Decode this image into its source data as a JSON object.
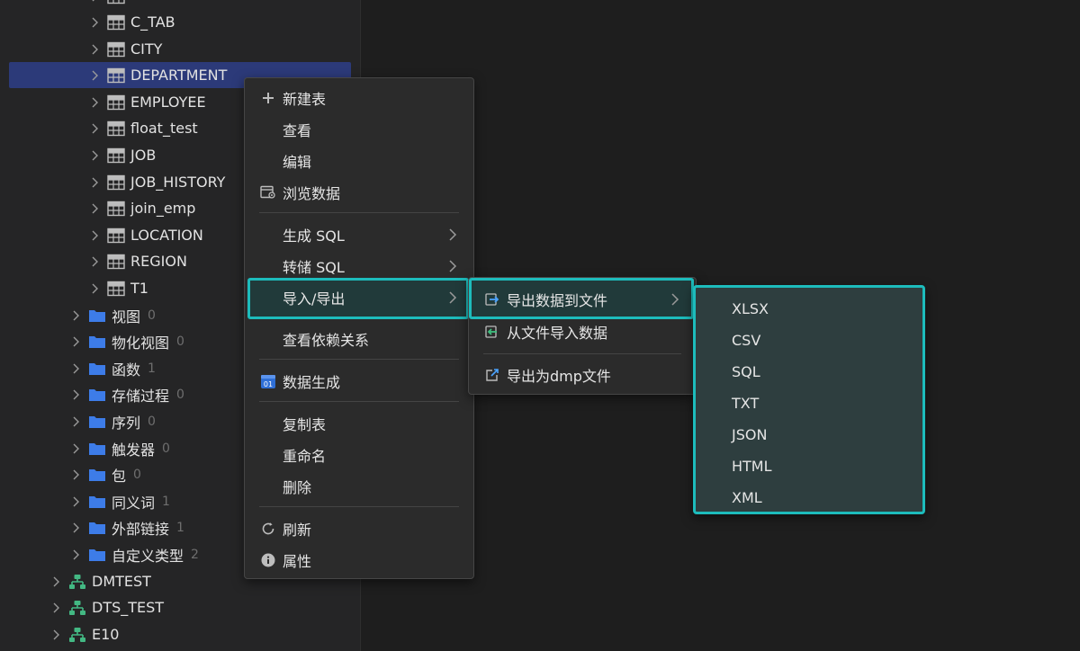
{
  "tree": {
    "tables": [
      {
        "label": "C_TAB"
      },
      {
        "label": "CITY"
      },
      {
        "label": "DEPARTMENT",
        "selected": true
      },
      {
        "label": "EMPLOYEE"
      },
      {
        "label": "float_test"
      },
      {
        "label": "JOB"
      },
      {
        "label": "JOB_HISTORY"
      },
      {
        "label": "join_emp"
      },
      {
        "label": "LOCATION"
      },
      {
        "label": "REGION"
      },
      {
        "label": "T1"
      }
    ],
    "folders": [
      {
        "label": "视图",
        "count": "0"
      },
      {
        "label": "物化视图",
        "count": "0"
      },
      {
        "label": "函数",
        "count": "1"
      },
      {
        "label": "存储过程",
        "count": "0"
      },
      {
        "label": "序列",
        "count": "0"
      },
      {
        "label": "触发器",
        "count": "0"
      },
      {
        "label": "包",
        "count": "0"
      },
      {
        "label": "同义词",
        "count": "1"
      },
      {
        "label": "外部链接",
        "count": "1"
      },
      {
        "label": "自定义类型",
        "count": "2"
      }
    ],
    "schemas": [
      {
        "label": "DMTEST"
      },
      {
        "label": "DTS_TEST"
      },
      {
        "label": "E10"
      }
    ]
  },
  "context_menu": {
    "new_table": "新建表",
    "view": "查看",
    "edit": "编辑",
    "browse_data": "浏览数据",
    "generate_sql": "生成 SQL",
    "dump_sql": "转储 SQL",
    "import_export": "导入/导出",
    "view_dependencies": "查看依赖关系",
    "data_generation": "数据生成",
    "copy_table": "复制表",
    "rename": "重命名",
    "delete": "删除",
    "refresh": "刷新",
    "properties": "属性"
  },
  "import_export_menu": {
    "export_to_file": "导出数据到文件",
    "import_from_file": "从文件导入数据",
    "export_dmp": "导出为dmp文件"
  },
  "format_menu": {
    "options": [
      "XLSX",
      "CSV",
      "SQL",
      "TXT",
      "JSON",
      "HTML",
      "XML"
    ]
  },
  "colors": {
    "accent": "#1dbcbc",
    "selection": "#2c3a79",
    "folder": "#3d7ce8",
    "schema": "#43b883"
  }
}
